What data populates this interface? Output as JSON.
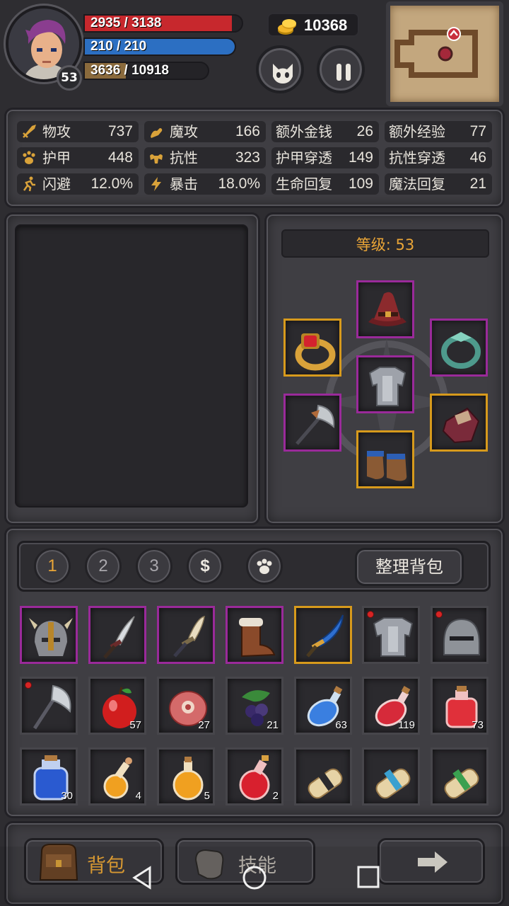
{
  "hud": {
    "hp_text": "2935 / 3138",
    "hp_fraction": 0.935,
    "mp_text": "210 / 210",
    "mp_fraction": 1.0,
    "exp_text": "3636 / 10918",
    "exp_fraction": 0.333,
    "level": "53",
    "gold": "10368",
    "colors": {
      "hp": "#c7282d",
      "mp": "#2c6fc2",
      "exp": "#8a6a3c"
    }
  },
  "stats": [
    {
      "label": "物攻",
      "value": "737",
      "icon": "sword-icon"
    },
    {
      "label": "魔攻",
      "value": "166",
      "icon": "magic-hand-icon"
    },
    {
      "label": "额外金钱",
      "value": "26",
      "icon": ""
    },
    {
      "label": "额外经验",
      "value": "77",
      "icon": ""
    },
    {
      "label": "护甲",
      "value": "448",
      "icon": "paw-shield-icon"
    },
    {
      "label": "抗性",
      "value": "323",
      "icon": "muscle-icon"
    },
    {
      "label": "护甲穿透",
      "value": "149",
      "icon": ""
    },
    {
      "label": "抗性穿透",
      "value": "46",
      "icon": ""
    },
    {
      "label": "闪避",
      "value": "12.0%",
      "icon": "running-icon"
    },
    {
      "label": "暴击",
      "value": "18.0%",
      "icon": "lightning-icon"
    },
    {
      "label": "生命回复",
      "value": "109",
      "icon": ""
    },
    {
      "label": "魔法回复",
      "value": "21",
      "icon": ""
    }
  ],
  "equipment": {
    "level_label": "等级: 53",
    "slots": [
      "hat-icon",
      "ruby-ring-icon",
      "jade-ring-icon",
      "armor-icon",
      "axe-icon",
      "gauntlet-icon",
      "boots-icon"
    ]
  },
  "inventory": {
    "tabs": [
      "1",
      "2",
      "3",
      "$",
      "paw-icon"
    ],
    "sort_label": "整理背包",
    "items": [
      {
        "icon": "horned-helmet-icon",
        "count": "",
        "rarity": "purple",
        "new": false
      },
      {
        "icon": "curved-dagger-icon",
        "count": "",
        "rarity": "purple",
        "new": false
      },
      {
        "icon": "bone-dagger-icon",
        "count": "",
        "rarity": "purple",
        "new": false
      },
      {
        "icon": "fur-boots-icon",
        "count": "",
        "rarity": "purple",
        "new": false
      },
      {
        "icon": "blue-scimitar-icon",
        "count": "",
        "rarity": "gold",
        "new": false
      },
      {
        "icon": "chest-armor-icon",
        "count": "",
        "rarity": "gray",
        "new": true
      },
      {
        "icon": "knight-helmet-icon",
        "count": "",
        "rarity": "gray",
        "new": true
      },
      {
        "icon": "battle-axe-icon",
        "count": "",
        "rarity": "gray",
        "new": true
      },
      {
        "icon": "apple-icon",
        "count": "57",
        "rarity": "gray",
        "new": false
      },
      {
        "icon": "meat-icon",
        "count": "27",
        "rarity": "gray",
        "new": false
      },
      {
        "icon": "berries-icon",
        "count": "21",
        "rarity": "gray",
        "new": false
      },
      {
        "icon": "blue-potion-icon",
        "count": "63",
        "rarity": "gray",
        "new": false
      },
      {
        "icon": "red-potion-icon",
        "count": "119",
        "rarity": "gray",
        "new": false
      },
      {
        "icon": "red-flask-icon",
        "count": "73",
        "rarity": "gray",
        "new": false
      },
      {
        "icon": "blue-jar-icon",
        "count": "30",
        "rarity": "gray",
        "new": false
      },
      {
        "icon": "orange-vial-icon",
        "count": "4",
        "rarity": "gray",
        "new": false
      },
      {
        "icon": "orange-flask-icon",
        "count": "5",
        "rarity": "gray",
        "new": false
      },
      {
        "icon": "red-orb-potion-icon",
        "count": "2",
        "rarity": "gray",
        "new": false
      },
      {
        "icon": "scroll-black-icon",
        "count": "",
        "rarity": "gray",
        "new": false
      },
      {
        "icon": "scroll-blue-icon",
        "count": "",
        "rarity": "gray",
        "new": false
      },
      {
        "icon": "scroll-green-icon",
        "count": "",
        "rarity": "gray",
        "new": false
      }
    ]
  },
  "bottom": {
    "bag_label": "背包",
    "skills_label": "技能",
    "next_icon": "arrow-right-icon"
  },
  "navbar": [
    "back-icon",
    "home-icon",
    "recents-icon"
  ]
}
